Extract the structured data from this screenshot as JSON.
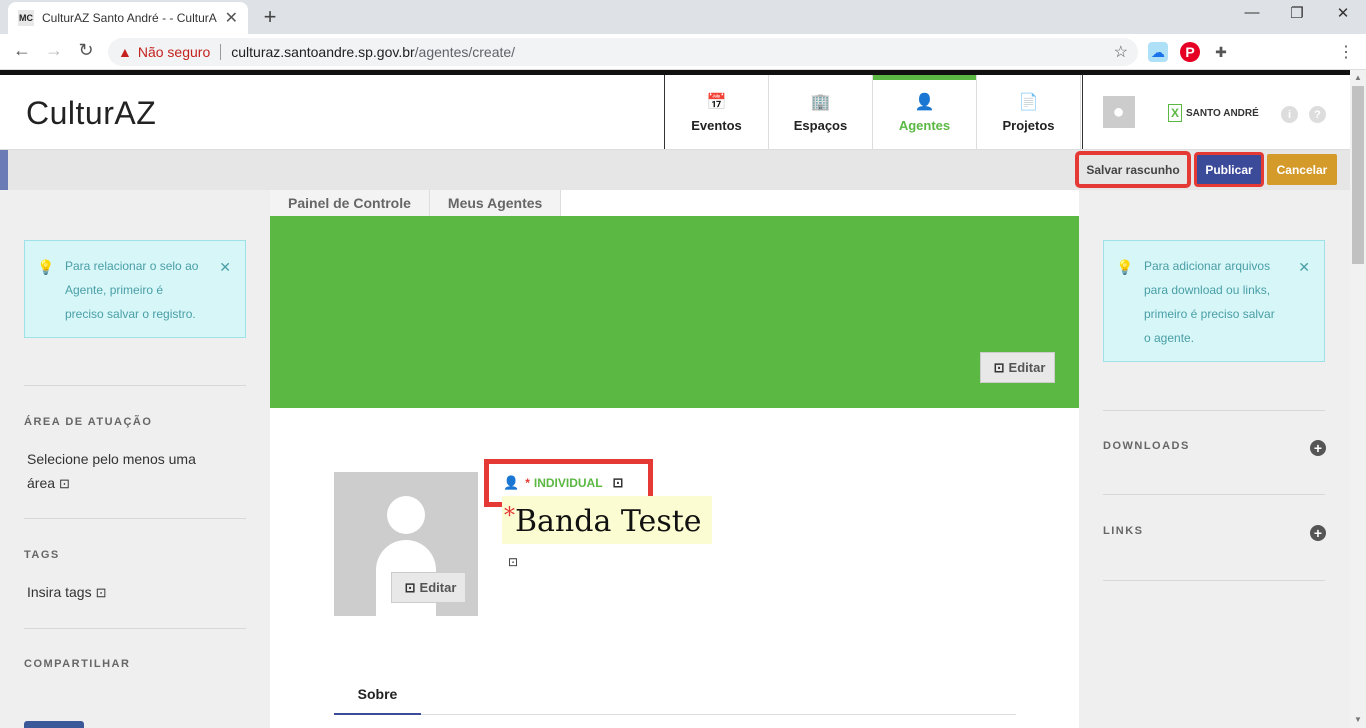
{
  "browser": {
    "tab_title": "CulturAZ Santo André - - CulturA",
    "favicon_text": "MC",
    "security_label": "Não seguro",
    "url_host": "culturaz.santoandre.sp.gov.br",
    "url_path": "/agentes/create/"
  },
  "site": {
    "logo": "CulturAZ",
    "nav": [
      "Eventos",
      "Espaços",
      "Agentes",
      "Projetos"
    ],
    "prefeitura": "SANTO ANDRÉ",
    "accent": "#5bb843"
  },
  "actions": {
    "save_draft": "Salvar rascunho",
    "publish": "Publicar",
    "cancel": "Cancelar"
  },
  "left": {
    "alert": "Para relacionar o selo ao Agente, primeiro é preciso salvar o registro.",
    "area_title": "ÁREA DE ATUAÇÃO",
    "area_text": "Selecione pelo menos uma área",
    "tags_title": "TAGS",
    "tags_text": "Insira tags",
    "share_title": "COMPARTILHAR"
  },
  "main": {
    "breadcrumb": [
      "Painel de Controle",
      "Meus Agentes"
    ],
    "edit_label": "Editar",
    "type_asterisk": "*",
    "type_label": "INDIVIDUAL",
    "name_required": "*",
    "name": "Banda Teste",
    "tab_about": "Sobre"
  },
  "right": {
    "alert": "Para adicionar arquivos para download ou links, primeiro é preciso salvar o agente.",
    "downloads_title": "DOWNLOADS",
    "links_title": "LINKS"
  }
}
